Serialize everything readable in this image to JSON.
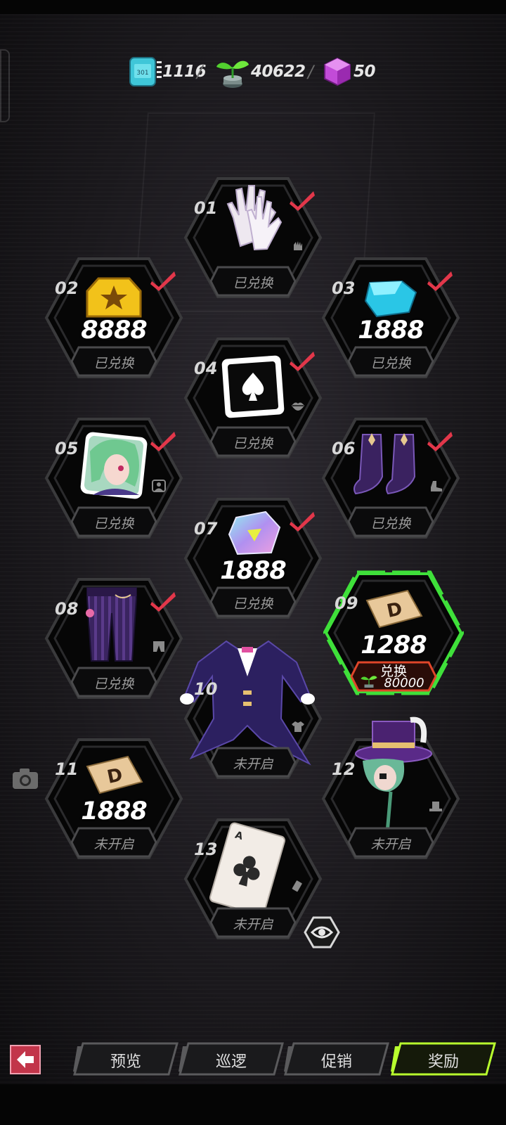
{
  "currencies": [
    {
      "id": "chip",
      "icon": "chip-icon",
      "value": "1116"
    },
    {
      "id": "sprout",
      "icon": "sprout-icon",
      "value": "40622"
    },
    {
      "id": "cube",
      "icon": "cube-icon",
      "value": "50"
    }
  ],
  "rewards": [
    {
      "num": "01",
      "item": "white-gloves",
      "type_icon": "glove-icon",
      "amount": "",
      "status": "已兑换",
      "claimed": true
    },
    {
      "num": "02",
      "item": "gold-star-badge",
      "type_icon": "",
      "amount": "8888",
      "status": "已兑换",
      "claimed": true
    },
    {
      "num": "03",
      "item": "blue-crystal",
      "type_icon": "",
      "amount": "1888",
      "status": "已兑换",
      "claimed": true
    },
    {
      "num": "04",
      "item": "spade-card-frame",
      "type_icon": "lips-icon",
      "amount": "",
      "status": "已兑换",
      "claimed": true
    },
    {
      "num": "05",
      "item": "green-hair-avatar",
      "type_icon": "portrait-icon",
      "amount": "",
      "status": "已兑换",
      "claimed": true
    },
    {
      "num": "06",
      "item": "purple-boots",
      "type_icon": "boot-icon",
      "amount": "",
      "status": "已兑换",
      "claimed": true
    },
    {
      "num": "07",
      "item": "holo-gem",
      "type_icon": "",
      "amount": "1888",
      "status": "已兑换",
      "claimed": true
    },
    {
      "num": "08",
      "item": "striped-trousers",
      "type_icon": "pants-icon",
      "amount": "",
      "status": "已兑换",
      "claimed": true
    },
    {
      "num": "09",
      "item": "d-ticket",
      "type_icon": "",
      "amount": "1288",
      "status": "兑换",
      "claimed": false,
      "cost": "80000",
      "cost_icon": "sprout-icon"
    },
    {
      "num": "10",
      "item": "tailcoat-jacket",
      "type_icon": "shirt-icon",
      "amount": "",
      "status": "未开启",
      "claimed": false
    },
    {
      "num": "11",
      "item": "d-ticket",
      "type_icon": "",
      "amount": "1888",
      "status": "未开启",
      "claimed": false
    },
    {
      "num": "12",
      "item": "top-hat-character",
      "type_icon": "hat-icon",
      "amount": "",
      "status": "未开启",
      "claimed": false
    },
    {
      "num": "13",
      "item": "club-ace-card",
      "type_icon": "card-icon",
      "amount": "",
      "status": "未开启",
      "claimed": false
    }
  ],
  "tabs": [
    {
      "label": "预览",
      "active": false
    },
    {
      "label": "巡逻",
      "active": false
    },
    {
      "label": "促销",
      "active": false
    },
    {
      "label": "奖励",
      "active": true
    }
  ],
  "colors": {
    "accent": "#e2374a",
    "active_tab": "#b8ff2e",
    "highlight_frame": "#3fe03a",
    "cost_frame": "#e0462a"
  }
}
